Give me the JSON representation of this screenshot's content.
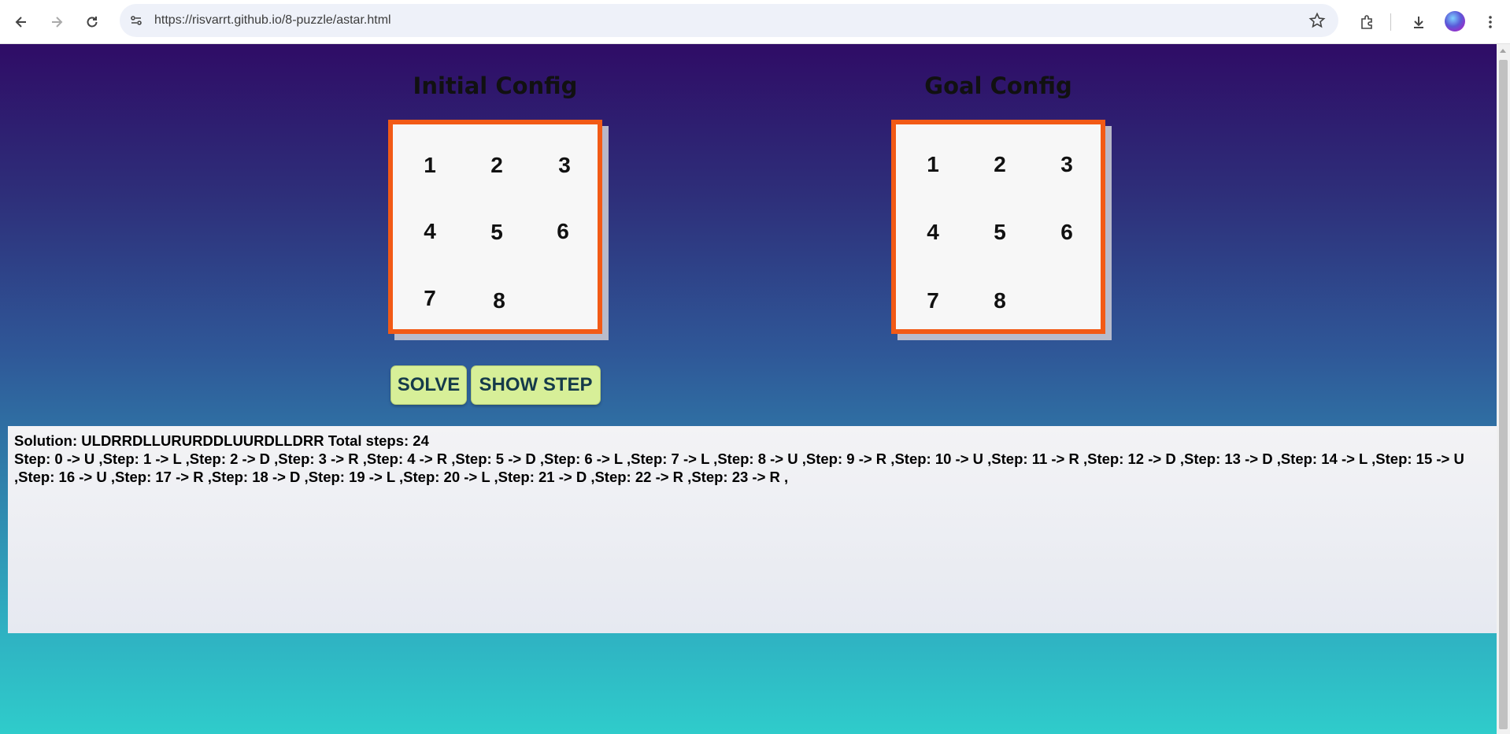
{
  "browser": {
    "url": "https://risvarrt.github.io/8-puzzle/astar.html",
    "icons": [
      "back-icon",
      "forward-icon",
      "reload-icon",
      "site-info-icon",
      "bookmark-star-icon",
      "extensions-icon",
      "downloads-icon",
      "profile-avatar",
      "menu-icon"
    ]
  },
  "page": {
    "initial": {
      "title": "Initial Config",
      "tiles": [
        "1",
        "2",
        "3",
        "4",
        "5",
        "6",
        "7",
        "8",
        ""
      ]
    },
    "goal": {
      "title": "Goal Config",
      "tiles": [
        "1",
        "2",
        "3",
        "4",
        "5",
        "6",
        "7",
        "8",
        ""
      ]
    },
    "buttons": {
      "solve": "SOLVE",
      "show_step": "SHOW STEP"
    },
    "output": {
      "solution_line": "Solution: ULDRRDLLURURDDLUURDLLDRR Total steps: 24",
      "steps_line": "Step: 0 -> U ,Step: 1 -> L ,Step: 2 -> D ,Step: 3 -> R ,Step: 4 -> R ,Step: 5 -> D ,Step: 6 -> L ,Step: 7 -> L ,Step: 8 -> U ,Step: 9 -> R ,Step: 10 -> U ,Step: 11 -> R ,Step: 12 -> D ,Step: 13 -> D ,Step: 14 -> L ,Step: 15 -> U ,Step: 16 -> U ,Step: 17 -> R ,Step: 18 -> D ,Step: 19 -> L ,Step: 20 -> L ,Step: 21 -> D ,Step: 22 -> R ,Step: 23 -> R ,"
    },
    "colors": {
      "board_border": "#f25a16",
      "button_bg": "#d7ef98",
      "gradient_top": "#2f0c66",
      "gradient_bottom": "#2fcccb"
    }
  }
}
